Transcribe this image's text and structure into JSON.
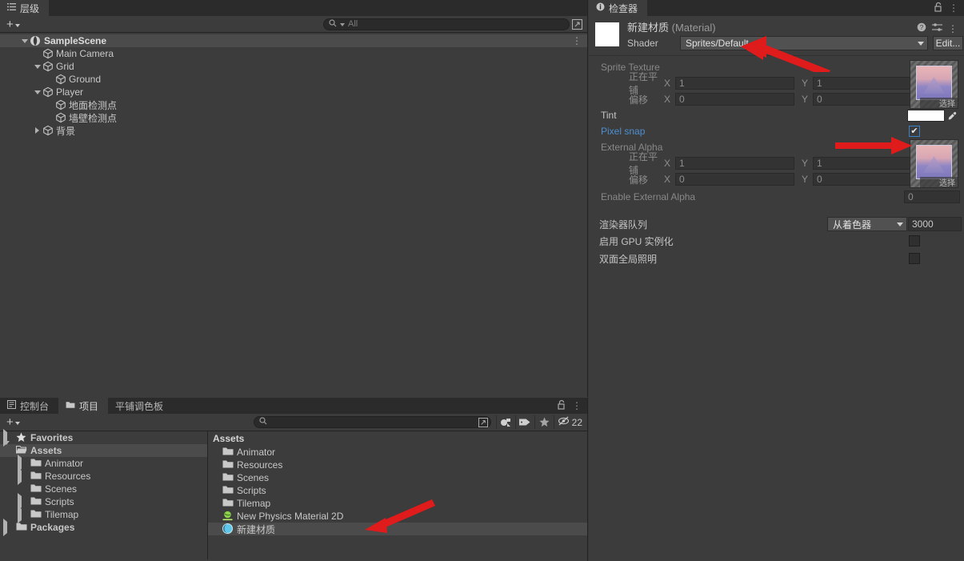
{
  "hierarchy": {
    "tab": {
      "label": "层级",
      "icon": "hierarchy-icon"
    },
    "search": {
      "placeholder": "All",
      "value": ""
    },
    "items": [
      {
        "label": "SampleScene",
        "icon": "scene-icon",
        "indent": 0,
        "fold": "down",
        "selected": true,
        "bold": true
      },
      {
        "label": "Main Camera",
        "icon": "gameobject-icon",
        "indent": 1,
        "fold": "none",
        "selected": false,
        "bold": false
      },
      {
        "label": "Grid",
        "icon": "gameobject-icon",
        "indent": 1,
        "fold": "down",
        "selected": false,
        "bold": false
      },
      {
        "label": "Ground",
        "icon": "gameobject-icon",
        "indent": 2,
        "fold": "none",
        "selected": false,
        "bold": false
      },
      {
        "label": "Player",
        "icon": "gameobject-icon",
        "indent": 1,
        "fold": "down",
        "selected": false,
        "bold": false
      },
      {
        "label": "地面检测点",
        "icon": "gameobject-icon",
        "indent": 2,
        "fold": "none",
        "selected": false,
        "bold": false
      },
      {
        "label": "墙壁检测点",
        "icon": "gameobject-icon",
        "indent": 2,
        "fold": "none",
        "selected": false,
        "bold": false
      },
      {
        "label": "背景",
        "icon": "gameobject-icon",
        "indent": 1,
        "fold": "right",
        "selected": false,
        "bold": false
      }
    ],
    "lock_icon": "lock-open-icon",
    "menu_icon": "kebab-menu-icon"
  },
  "inspector": {
    "tab": {
      "label": "检查器",
      "icon": "info-icon"
    },
    "lock_icon": "lock-open-icon",
    "menu_icon": "kebab-menu-icon",
    "material": {
      "name": "新建材质",
      "type_suffix": "(Material)",
      "preview_color": "#ffffff",
      "shader_label": "Shader",
      "shader_value": "Sprites/Default",
      "edit_label": "Edit...",
      "help_icon": "help-icon",
      "preset_icon": "preset-sliders-icon",
      "menu_icon": "kebab-menu-icon"
    },
    "properties": {
      "sprite_texture": {
        "label": "Sprite Texture",
        "tiling_label": "正在平铺",
        "offset_label": "偏移",
        "tiling": {
          "x": "1",
          "y": "1"
        },
        "offset": {
          "x": "0",
          "y": "0"
        },
        "axis_x": "X",
        "axis_y": "Y",
        "thumb_select_label": "选择"
      },
      "tint": {
        "label": "Tint",
        "color": "#ffffff",
        "eyedropper_icon": "eyedropper-icon"
      },
      "pixel_snap": {
        "label": "Pixel snap",
        "checked": true,
        "color": "#4e8fd0"
      },
      "external_alpha": {
        "label": "External Alpha",
        "tiling_label": "正在平铺",
        "offset_label": "偏移",
        "tiling": {
          "x": "1",
          "y": "1"
        },
        "offset": {
          "x": "0",
          "y": "0"
        },
        "axis_x": "X",
        "axis_y": "Y",
        "thumb_select_label": "选择"
      },
      "enable_external_alpha": {
        "label": "Enable External Alpha",
        "value": "0"
      },
      "render_queue": {
        "label": "渲染器队列",
        "mode": "从着色器",
        "value": "3000"
      },
      "gpu_instancing": {
        "label": "启用 GPU 实例化",
        "checked": false
      },
      "double_sided_gi": {
        "label": "双面全局照明",
        "checked": false
      }
    }
  },
  "project": {
    "tabs": [
      {
        "label": "控制台",
        "icon": "console-icon",
        "active": false
      },
      {
        "label": "项目",
        "icon": "folder-icon",
        "active": true
      },
      {
        "label": "平铺调色板",
        "icon": "none",
        "active": false
      }
    ],
    "lock_icon": "lock-open-icon",
    "menu_icon": "kebab-menu-icon",
    "search": {
      "placeholder": "",
      "value": ""
    },
    "toolbar_icons": [
      {
        "name": "search-popout-icon"
      },
      {
        "name": "asset-type-filter-icon"
      },
      {
        "name": "label-filter-icon"
      },
      {
        "name": "favorite-filter-icon"
      }
    ],
    "hidden_count": {
      "icon": "eye-slash-icon",
      "value": "22"
    },
    "tree": [
      {
        "label": "Favorites",
        "icon": "star-icon",
        "indent": 0,
        "fold": "right",
        "selected": false,
        "bold": true
      },
      {
        "label": "Assets",
        "icon": "folder-open-icon",
        "indent": 0,
        "fold": "down",
        "selected": true,
        "bold": true
      },
      {
        "label": "Animator",
        "icon": "folder-icon",
        "indent": 1,
        "fold": "right",
        "selected": false,
        "bold": false
      },
      {
        "label": "Resources",
        "icon": "folder-icon",
        "indent": 1,
        "fold": "right",
        "selected": false,
        "bold": false
      },
      {
        "label": "Scenes",
        "icon": "folder-icon",
        "indent": 1,
        "fold": "none",
        "selected": false,
        "bold": false
      },
      {
        "label": "Scripts",
        "icon": "folder-icon",
        "indent": 1,
        "fold": "right",
        "selected": false,
        "bold": false
      },
      {
        "label": "Tilemap",
        "icon": "folder-icon",
        "indent": 1,
        "fold": "right",
        "selected": false,
        "bold": false
      },
      {
        "label": "Packages",
        "icon": "folder-icon",
        "indent": 0,
        "fold": "right",
        "selected": false,
        "bold": true
      }
    ],
    "breadcrumb": "Assets",
    "assets": [
      {
        "label": "Animator",
        "icon": "folder-icon",
        "selected": false
      },
      {
        "label": "Resources",
        "icon": "folder-icon",
        "selected": false
      },
      {
        "label": "Scenes",
        "icon": "folder-icon",
        "selected": false
      },
      {
        "label": "Scripts",
        "icon": "folder-icon",
        "selected": false
      },
      {
        "label": "Tilemap",
        "icon": "folder-icon",
        "selected": false
      },
      {
        "label": "New Physics Material 2D",
        "icon": "physics-material-icon",
        "selected": false
      },
      {
        "label": "新建材质",
        "icon": "material-icon",
        "selected": true
      }
    ]
  },
  "annotations": {
    "arrow_color": "#e01b1b",
    "arrows": [
      {
        "name": "arrow-to-shader-dropdown"
      },
      {
        "name": "arrow-to-pixel-snap-checkbox"
      },
      {
        "name": "arrow-to-new-material-asset"
      }
    ]
  }
}
